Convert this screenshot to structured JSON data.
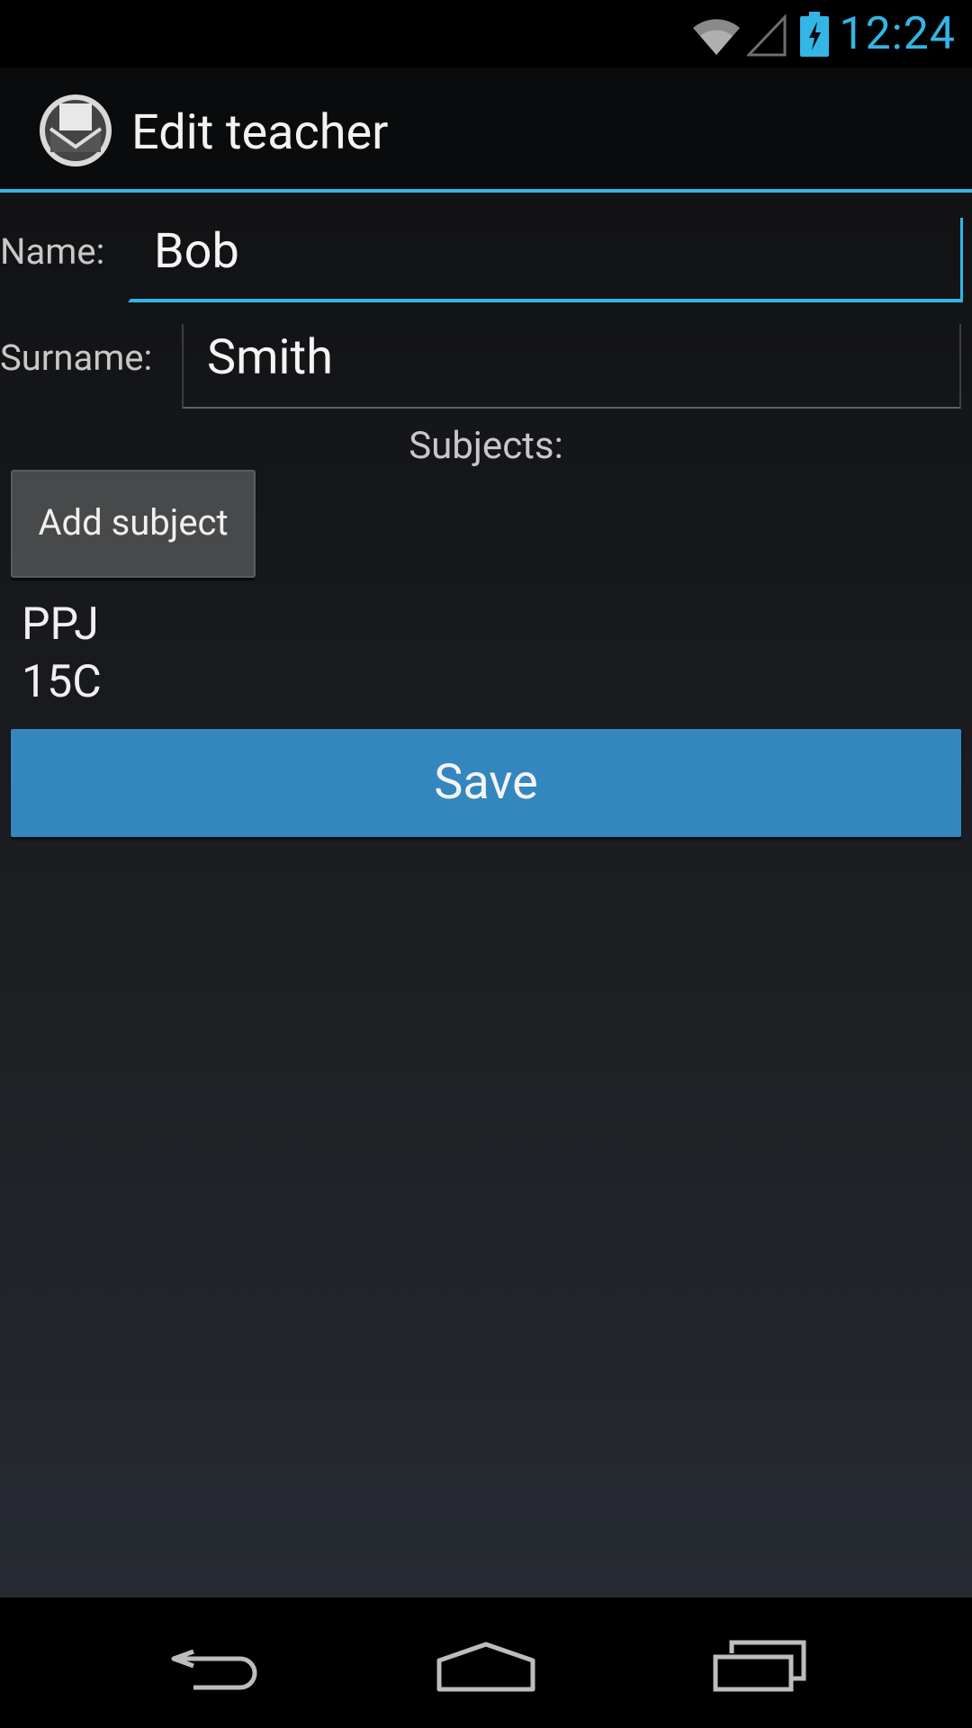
{
  "status_bar": {
    "time": "12:24",
    "icons": [
      "wifi-icon",
      "cell-signal-icon",
      "battery-charging-icon"
    ]
  },
  "action_bar": {
    "title": "Edit teacher",
    "logo_icon": "virtual-university-logo"
  },
  "form": {
    "name_label": "Name:",
    "name_value": "Bob",
    "surname_label": "Surname:",
    "surname_value": "Smith",
    "subjects_label": "Subjects:"
  },
  "buttons": {
    "add_subject": "Add subject",
    "save": "Save"
  },
  "subjects": [
    "PPJ",
    "15C"
  ],
  "nav_bar": {
    "icons": [
      "back-icon",
      "home-icon",
      "recents-icon"
    ]
  },
  "colors": {
    "accent": "#33b5e5",
    "save_button": "#3387be"
  }
}
